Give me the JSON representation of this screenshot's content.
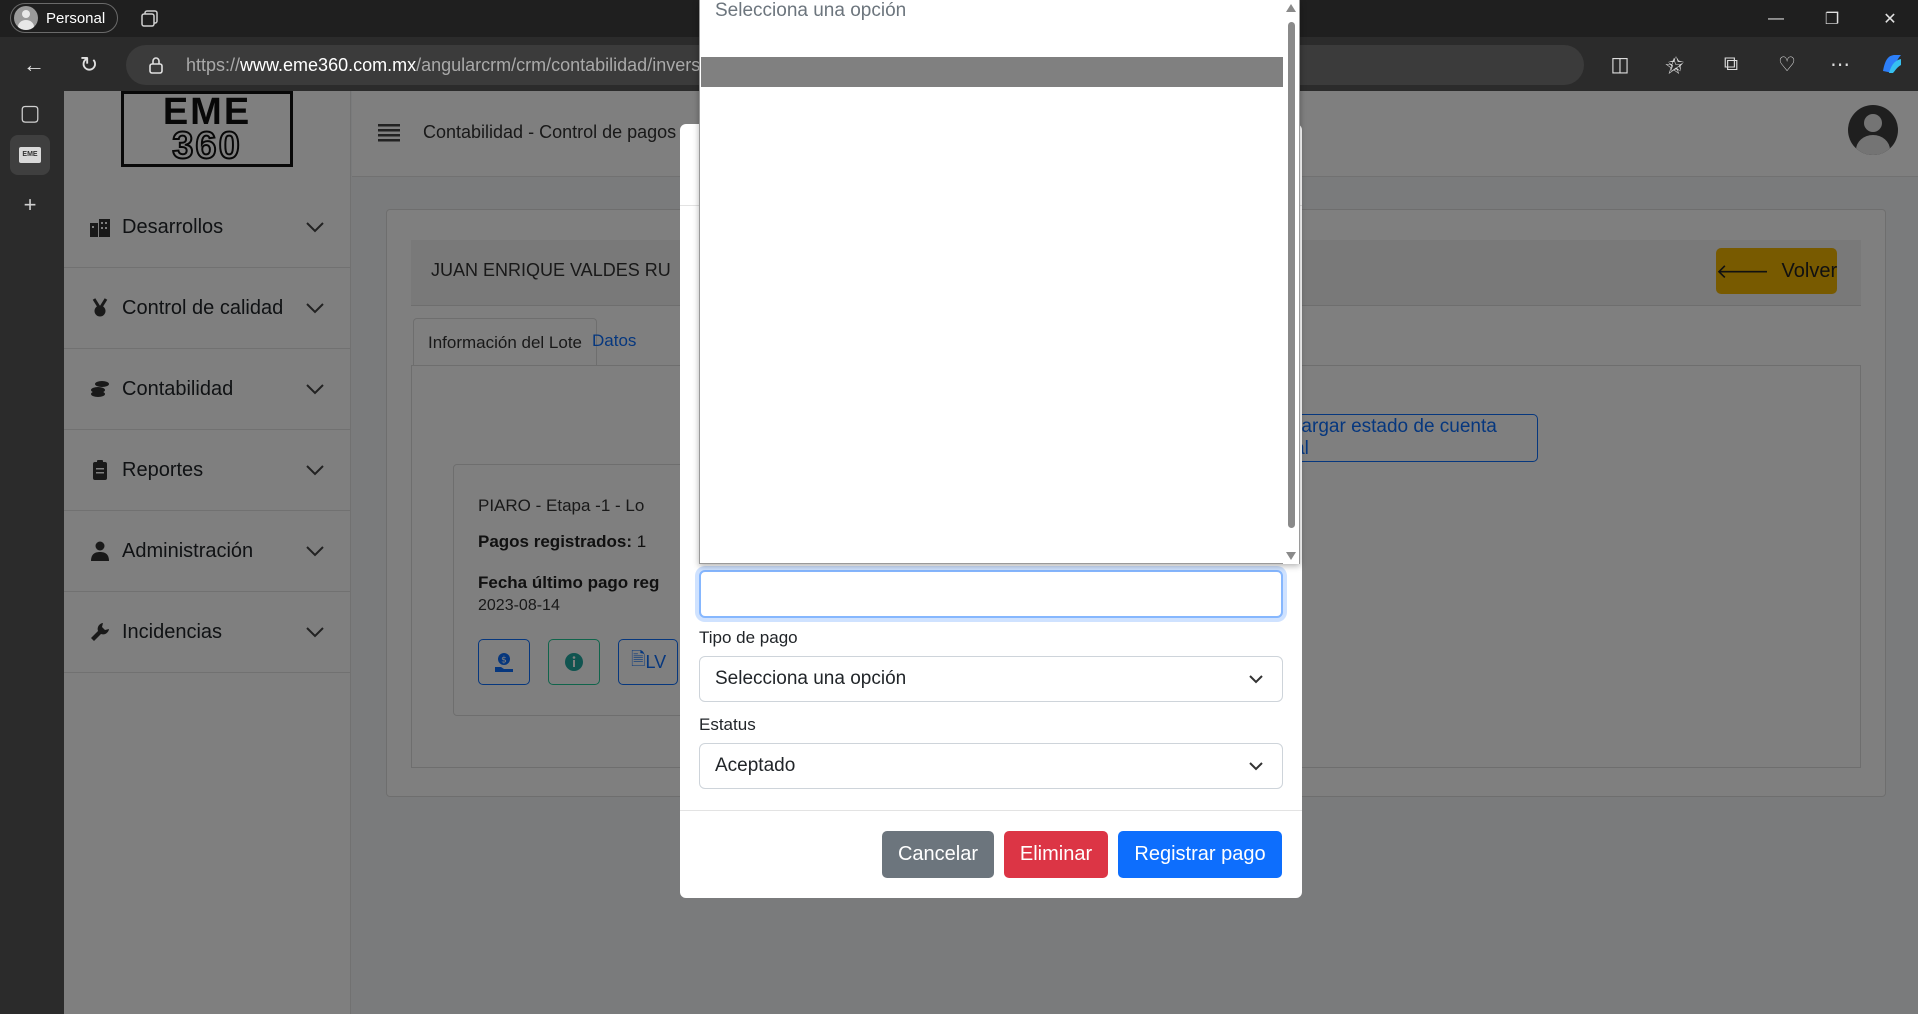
{
  "browser": {
    "profile_label": "Personal",
    "url_scheme": "https://",
    "url_host": "www.eme360.com.mx",
    "url_path": "/angularcrm/crm/contabilidad/inversi"
  },
  "app": {
    "logo_line1": "EME",
    "logo_line2": "360",
    "breadcrumb": "Contabilidad - Control de pagos",
    "sidebar": {
      "items": [
        {
          "label": "Desarrollos",
          "icon": "building-icon"
        },
        {
          "label": "Control de calidad",
          "icon": "medal-icon"
        },
        {
          "label": "Contabilidad",
          "icon": "coins-icon"
        },
        {
          "label": "Reportes",
          "icon": "clipboard-icon"
        },
        {
          "label": "Administración",
          "icon": "user-tie-icon"
        },
        {
          "label": "Incidencias",
          "icon": "wrench-icon"
        }
      ]
    }
  },
  "main": {
    "client_name": "JUAN ENRIQUE VALDES RU",
    "volver_label": "Volver",
    "tabs": [
      {
        "label": "Información del Lote"
      },
      {
        "label": "Datos"
      }
    ],
    "download_label": "Descargar estado de cuenta global",
    "lote": {
      "title": "PIARO - Etapa -1 - Lo",
      "pagos_label": "Pagos registrados:",
      "pagos_value": "1",
      "fecha_label": "Fecha último pago reg",
      "fecha_value": "2023-08-14",
      "lv_label": "LV"
    }
  },
  "modal": {
    "tipo_pago_label": "Tipo de pago",
    "tipo_pago_value": "Selecciona una opción",
    "estatus_label": "Estatus",
    "estatus_value": "Aceptado",
    "cancel_label": "Cancelar",
    "delete_label": "Eliminar",
    "submit_label": "Registrar pago"
  },
  "dropdown": {
    "placeholder_option": "Selecciona una opción"
  },
  "colors": {
    "primary": "#0d6efd",
    "danger": "#dc3545",
    "secondary": "#6c757d",
    "warning": "#f0b400"
  }
}
